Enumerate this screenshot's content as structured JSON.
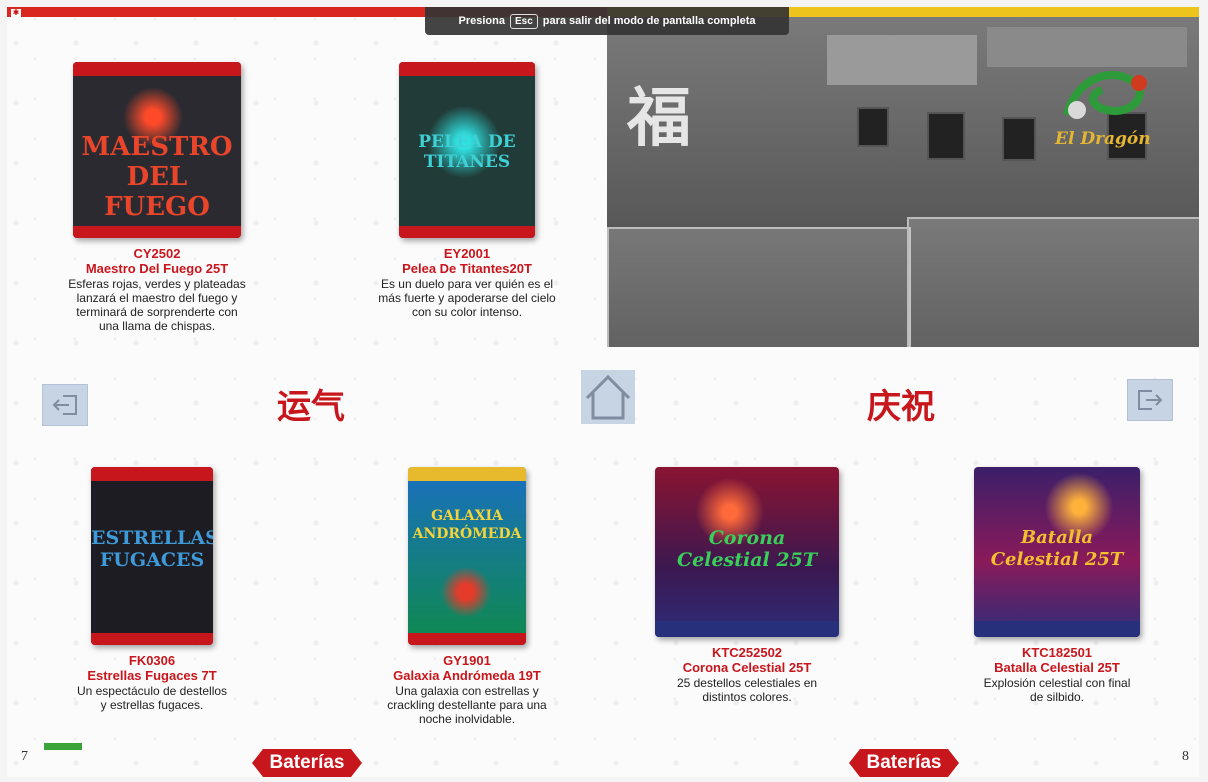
{
  "fullscreen_banner": {
    "prefix": "Presiona",
    "key": "Esc",
    "suffix": "para salir del modo de pantalla completa"
  },
  "left_page": {
    "page_number": "7",
    "section_tag": "Baterías",
    "chinese_title": "运气",
    "products": [
      {
        "code": "CY2502",
        "name": "Maestro Del Fuego 25T",
        "desc": [
          "Esferas rojas, verdes y plateadas",
          "lanzará el maestro del fuego y",
          "terminará de sorprenderte con",
          "una llama de chispas."
        ],
        "box_text": [
          "MAESTRO",
          "DEL FUEGO"
        ]
      },
      {
        "code": "EY2001",
        "name": "Pelea De Titantes20T",
        "desc": [
          "Es un duelo para ver quién es el",
          "más fuerte y apoderarse del cielo",
          "con su color intenso."
        ],
        "box_text": [
          "PELEA DE",
          "TITANES"
        ]
      },
      {
        "code": "FK0306",
        "name": "Estrellas Fugaces 7T",
        "desc": [
          "Un espectáculo de destellos",
          "y estrellas fugaces."
        ],
        "box_text": [
          "ESTRELLAS",
          "FUGACES"
        ]
      },
      {
        "code": "GY1901",
        "name": "Galaxia Andrómeda 19T",
        "desc": [
          "Una galaxia con estrellas y",
          "crackling destellante para una",
          "noche inolvidable."
        ],
        "box_text": [
          "GALAXIA",
          "ANDRÓMEDA"
        ]
      }
    ]
  },
  "right_page": {
    "page_number": "8",
    "section_tag": "Baterías",
    "chinese_title": "庆祝",
    "photo": {
      "sign": "福",
      "logo_text": "El Dragón"
    },
    "products": [
      {
        "code": "KTC252502",
        "name": "Corona Celestial 25T",
        "desc": [
          "25 destellos celestiales en",
          "distintos colores."
        ],
        "box_text": [
          "Corona",
          "Celestial 25T"
        ]
      },
      {
        "code": "KTC182501",
        "name": "Batalla Celestial 25T",
        "desc": [
          "Explosión celestial con final",
          "de silbido."
        ],
        "box_text": [
          "Batalla",
          "Celestial 25T"
        ]
      }
    ]
  },
  "colors": {
    "brand_red": "#c8161d",
    "band_yellow": "#ecc41c",
    "nav_blue": "#c7d4e4"
  }
}
